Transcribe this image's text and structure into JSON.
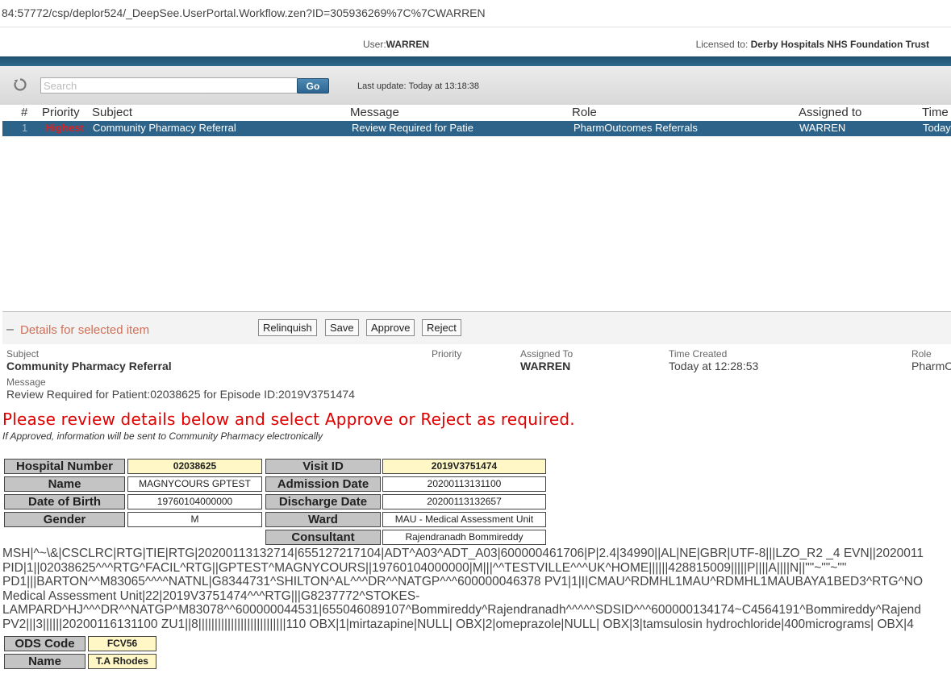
{
  "address_bar": {
    "url": "84:57772/csp/deplor524/_DeepSee.UserPortal.Workflow.zen?ID=305936269%7C%7CWARREN"
  },
  "userbar": {
    "user_label": "User:",
    "user": "WARREN",
    "licensed_label": "Licensed to:",
    "licensed_to": "Derby Hospitals NHS Foundation Trust"
  },
  "toolbar": {
    "search_placeholder": "Search",
    "go_label": "Go",
    "last_update_label": "Last update:",
    "last_update_value": "Today at 13:18:38"
  },
  "table": {
    "headers": {
      "num": "#",
      "priority": "Priority",
      "subject": "Subject",
      "message": "Message",
      "role": "Role",
      "assigned": "Assigned to",
      "time": "Time"
    },
    "rows": [
      {
        "num": "1",
        "priority": "Highest",
        "subject": "Community Pharmacy Referral",
        "message": "Review Required for Patie",
        "role": "PharmOutcomes Referrals",
        "assigned": "WARREN",
        "time": "Today"
      }
    ]
  },
  "details": {
    "toggle": "–",
    "title": "Details for selected item",
    "buttons": {
      "relinquish": "Relinquish",
      "save": "Save",
      "approve": "Approve",
      "reject": "Reject"
    },
    "subject_label": "Subject",
    "subject": "Community Pharmacy Referral",
    "priority_label": "Priority",
    "assigned_label": "Assigned To",
    "assigned": "WARREN",
    "time_label": "Time Created",
    "time": "Today at 12:28:53",
    "role_label": "Role",
    "role": "PharmC",
    "message_label": "Message",
    "message": "Review Required for Patient:02038625 for Episode ID:2019V3751474"
  },
  "instructions": {
    "alert": "Please review details below and select Approve or Reject as required.",
    "note": "If Approved, information will be sent to Community Pharmacy electronically"
  },
  "patient": {
    "hospital_number_label": "Hospital Number",
    "hospital_number": "02038625",
    "visit_id_label": "Visit ID",
    "visit_id": "2019V3751474",
    "name_label": "Name",
    "name": "MAGNYCOURS GPTEST",
    "admission_label": "Admission Date",
    "admission": "20200113131100",
    "dob_label": "Date of Birth",
    "dob": "19760104000000",
    "discharge_label": "Discharge Date",
    "discharge": "20200113132657",
    "gender_label": "Gender",
    "gender": "M",
    "ward_label": "Ward",
    "ward": "MAU - Medical Assessment Unit",
    "consultant_label": "Consultant",
    "consultant": "Rajendranadh Bommireddy"
  },
  "hl7_lines": [
    "MSH|^~\\&|CSCLRC|RTG|TIE|RTG|20200113132714|655127217104|ADT^A03^ADT_A03|600000461706|P|2.4|34990||AL|NE|GBR|UTF-8|||LZO_R2 _4 EVN||2020011",
    "PID|1||02038625^^^RTG^FACIL^RTG||GPTEST^MAGNYCOURS||19760104000000|M|||^^TESTVILLE^^^UK^HOME||||||428815009|||||P||||A||||N||\"\"~\"\"~\"\"",
    "PD1|||BARTON^^M83065^^^^NATNL|G8344731^SHILTON^AL^^^DR^^NATGP^^^600000046378 PV1|1|I|CMAU^RDMHL1MAU^RDMHL1MAUBAYA1BED3^RTG^NO",
    "Medical Assessment Unit|22|2019V3751474^^^RTG|||G8237772^STOKES-",
    "LAMPARD^HJ^^^DR^^NATGP^M83078^^600000044531|655046089107^Bommireddy^Rajendranadh^^^^^SDSID^^^600000134174~C4564191^Bommireddy^Rajend",
    "PV2|||3||||||20200116131100 ZU1||8|||||||||||||||||||||||||||110 OBX|1|mirtazapine|NULL| OBX|2|omeprazole|NULL| OBX|3|tamsulosin hydrochloride|400micrograms| OBX|4"
  ],
  "pharmacy": {
    "ods_label": "ODS Code",
    "ods": "FCV56",
    "name_label": "Name",
    "name": "T.A Rhodes"
  }
}
